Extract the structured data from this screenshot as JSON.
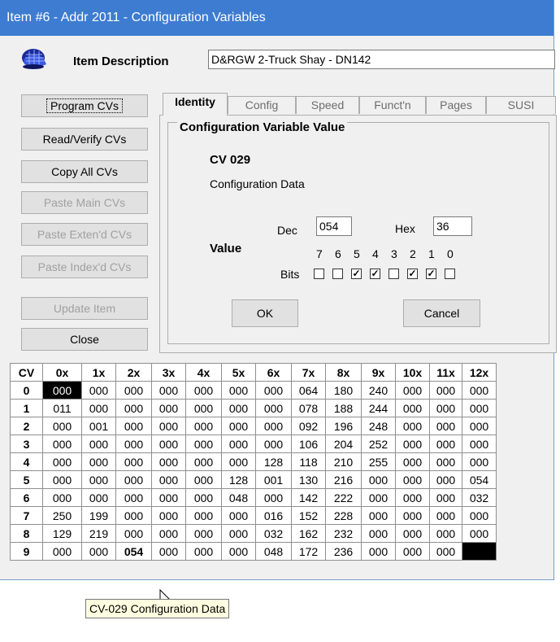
{
  "window": {
    "title": "Item #6 - Addr 2011 - Configuration Variables"
  },
  "header": {
    "logo_icon": "cap-icon",
    "description_label": "Item Description",
    "description_value": "D&RGW 2-Truck Shay - DN142"
  },
  "actions": {
    "program": "Program CVs",
    "read_verify": "Read/Verify CVs",
    "copy_all": "Copy All CVs",
    "paste_main": "Paste Main CVs",
    "paste_extend": "Paste Exten'd CVs",
    "paste_index": "Paste Index'd CVs",
    "update_item": "Update Item",
    "close": "Close"
  },
  "tabs": [
    "Identity",
    "Config",
    "Speed",
    "Funct'n",
    "Pages",
    "SUSI"
  ],
  "active_tab": "Identity",
  "cv_panel": {
    "group_title": "Configuration Variable Value",
    "cv_number": "CV 029",
    "cv_description": "Configuration Data",
    "value_label": "Value",
    "dec_label": "Dec",
    "dec_value": "054",
    "hex_label": "Hex",
    "hex_value": "36",
    "bits_label": "Bits",
    "bit_numbers": [
      "7",
      "6",
      "5",
      "4",
      "3",
      "2",
      "1",
      "0"
    ],
    "bit_states": [
      false,
      false,
      true,
      true,
      false,
      true,
      true,
      false
    ],
    "ok": "OK",
    "cancel": "Cancel"
  },
  "grid": {
    "headers": [
      "CV",
      "0x",
      "1x",
      "2x",
      "3x",
      "4x",
      "5x",
      "6x",
      "7x",
      "8x",
      "9x",
      "10x",
      "11x",
      "12x"
    ],
    "rows": [
      [
        "0",
        "000",
        "000",
        "000",
        "000",
        "000",
        "000",
        "000",
        "064",
        "180",
        "240",
        "000",
        "000",
        "000"
      ],
      [
        "1",
        "011",
        "000",
        "000",
        "000",
        "000",
        "000",
        "000",
        "078",
        "188",
        "244",
        "000",
        "000",
        "000"
      ],
      [
        "2",
        "000",
        "001",
        "000",
        "000",
        "000",
        "000",
        "000",
        "092",
        "196",
        "248",
        "000",
        "000",
        "000"
      ],
      [
        "3",
        "000",
        "000",
        "000",
        "000",
        "000",
        "000",
        "000",
        "106",
        "204",
        "252",
        "000",
        "000",
        "000"
      ],
      [
        "4",
        "000",
        "000",
        "000",
        "000",
        "000",
        "000",
        "128",
        "118",
        "210",
        "255",
        "000",
        "000",
        "000"
      ],
      [
        "5",
        "000",
        "000",
        "000",
        "000",
        "000",
        "128",
        "001",
        "130",
        "216",
        "000",
        "000",
        "000",
        "054"
      ],
      [
        "6",
        "000",
        "000",
        "000",
        "000",
        "000",
        "048",
        "000",
        "142",
        "222",
        "000",
        "000",
        "000",
        "032"
      ],
      [
        "7",
        "250",
        "199",
        "000",
        "000",
        "000",
        "000",
        "016",
        "152",
        "228",
        "000",
        "000",
        "000",
        "000"
      ],
      [
        "8",
        "129",
        "219",
        "000",
        "000",
        "000",
        "000",
        "032",
        "162",
        "232",
        "000",
        "000",
        "000",
        "000"
      ],
      [
        "9",
        "000",
        "000",
        "054",
        "000",
        "000",
        "000",
        "048",
        "172",
        "236",
        "000",
        "000",
        "000",
        ""
      ]
    ],
    "selected_cell": "CV 0",
    "highlighted_value": "054"
  },
  "tooltip": "CV-029 Configuration Data",
  "colors": {
    "titlebar": "#3d7cd1",
    "selection": "#000000",
    "tooltip_bg": "#ffffe1"
  }
}
